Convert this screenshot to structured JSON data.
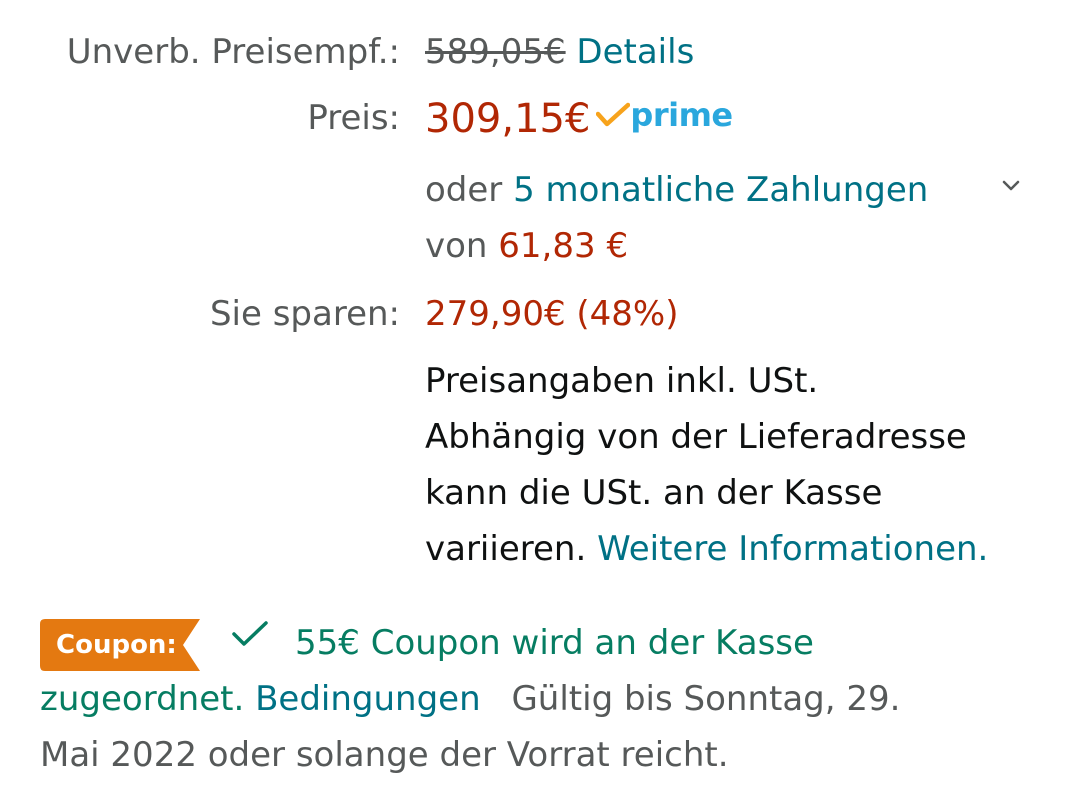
{
  "list_price": {
    "label": "Unverb. Preisempf.:",
    "value": "589,05€",
    "details_link": "Details"
  },
  "price": {
    "label": "Preis:",
    "value": "309,15€",
    "prime_text": "prime"
  },
  "installments": {
    "prefix": "oder",
    "link": "5 monatliche Zahlungen",
    "from_prefix": "von",
    "amount": "61,83 €"
  },
  "savings": {
    "label": "Sie sparen:",
    "value": "279,90€ (48%)"
  },
  "tax_note": {
    "line1": "Preisangaben inkl. USt.",
    "line2": "Abhängig von der Lieferadresse",
    "line3": "kann die USt. an der Kasse",
    "line4_text": "variieren.",
    "line4_link": "Weitere Informationen."
  },
  "coupon": {
    "badge_label": "Coupon:",
    "applied_text_1": "55€ Coupon wird an der Kasse",
    "applied_text_2": "zugeordnet.",
    "terms_link": "Bedingungen",
    "validity_1": "Gültig bis Sonntag, 29.",
    "validity_2": "Mai 2022 oder solange der Vorrat reicht."
  },
  "colors": {
    "price_red": "#b12704",
    "link_teal": "#007185",
    "label_grey": "#565959",
    "coupon_orange": "#e47911",
    "coupon_green": "#067d62",
    "prime_blue": "#2aa7dd",
    "prime_check": "#f7a31c"
  },
  "icons": {
    "prime_check": "prime-check-icon",
    "chevron": "chevron-down-icon",
    "coupon_check": "checkmark-icon"
  }
}
